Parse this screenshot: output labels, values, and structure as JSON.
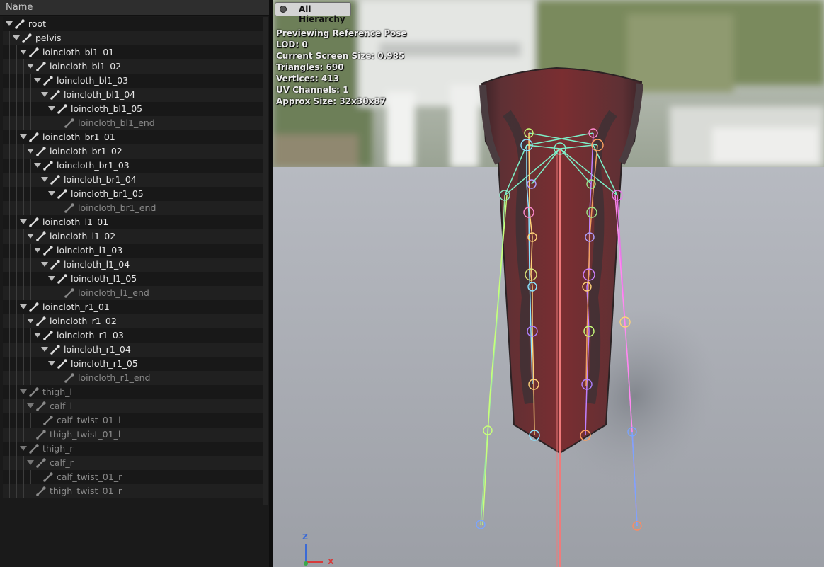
{
  "tree": {
    "header": "Name",
    "rows": [
      {
        "label": "root",
        "depth": 0,
        "expand": true,
        "dim": false
      },
      {
        "label": "pelvis",
        "depth": 1,
        "expand": true,
        "dim": false
      },
      {
        "label": "loincloth_bl1_01",
        "depth": 2,
        "expand": true,
        "dim": false
      },
      {
        "label": "loincloth_bl1_02",
        "depth": 3,
        "expand": true,
        "dim": false
      },
      {
        "label": "loincloth_bl1_03",
        "depth": 4,
        "expand": true,
        "dim": false
      },
      {
        "label": "loincloth_bl1_04",
        "depth": 5,
        "expand": true,
        "dim": false
      },
      {
        "label": "loincloth_bl1_05",
        "depth": 6,
        "expand": true,
        "dim": false
      },
      {
        "label": "loincloth_bl1_end",
        "depth": 7,
        "expand": false,
        "dim": true
      },
      {
        "label": "loincloth_br1_01",
        "depth": 2,
        "expand": true,
        "dim": false
      },
      {
        "label": "loincloth_br1_02",
        "depth": 3,
        "expand": true,
        "dim": false
      },
      {
        "label": "loincloth_br1_03",
        "depth": 4,
        "expand": true,
        "dim": false
      },
      {
        "label": "loincloth_br1_04",
        "depth": 5,
        "expand": true,
        "dim": false
      },
      {
        "label": "loincloth_br1_05",
        "depth": 6,
        "expand": true,
        "dim": false
      },
      {
        "label": "loincloth_br1_end",
        "depth": 7,
        "expand": false,
        "dim": true
      },
      {
        "label": "loincloth_l1_01",
        "depth": 2,
        "expand": true,
        "dim": false
      },
      {
        "label": "loincloth_l1_02",
        "depth": 3,
        "expand": true,
        "dim": false
      },
      {
        "label": "loincloth_l1_03",
        "depth": 4,
        "expand": true,
        "dim": false
      },
      {
        "label": "loincloth_l1_04",
        "depth": 5,
        "expand": true,
        "dim": false
      },
      {
        "label": "loincloth_l1_05",
        "depth": 6,
        "expand": true,
        "dim": false
      },
      {
        "label": "loincloth_l1_end",
        "depth": 7,
        "expand": false,
        "dim": true
      },
      {
        "label": "loincloth_r1_01",
        "depth": 2,
        "expand": true,
        "dim": false
      },
      {
        "label": "loincloth_r1_02",
        "depth": 3,
        "expand": true,
        "dim": false
      },
      {
        "label": "loincloth_r1_03",
        "depth": 4,
        "expand": true,
        "dim": false
      },
      {
        "label": "loincloth_r1_04",
        "depth": 5,
        "expand": true,
        "dim": false
      },
      {
        "label": "loincloth_r1_05",
        "depth": 6,
        "expand": true,
        "dim": false
      },
      {
        "label": "loincloth_r1_end",
        "depth": 7,
        "expand": false,
        "dim": true
      },
      {
        "label": "thigh_l",
        "depth": 2,
        "expand": true,
        "dim": true
      },
      {
        "label": "calf_l",
        "depth": 3,
        "expand": true,
        "dim": true
      },
      {
        "label": "calf_twist_01_l",
        "depth": 4,
        "expand": false,
        "dim": true
      },
      {
        "label": "thigh_twist_01_l",
        "depth": 3,
        "expand": false,
        "dim": true
      },
      {
        "label": "thigh_r",
        "depth": 2,
        "expand": true,
        "dim": true
      },
      {
        "label": "calf_r",
        "depth": 3,
        "expand": true,
        "dim": true
      },
      {
        "label": "calf_twist_01_r",
        "depth": 4,
        "expand": false,
        "dim": true
      },
      {
        "label": "thigh_twist_01_r",
        "depth": 3,
        "expand": false,
        "dim": true
      }
    ]
  },
  "viewport": {
    "hierarchy_button": "All Hierarchy",
    "stats": [
      "Previewing Reference Pose",
      "LOD: 0",
      "Current Screen Size: 0.985",
      "Triangles: 690",
      "Vertices: 413",
      "UV Channels: 1",
      "Approx Size: 32x30x87"
    ],
    "axis": {
      "z": "Z",
      "x": "X"
    }
  },
  "icons": {
    "bone": "bone-icon",
    "expand": "expand-arrow-icon"
  },
  "colors": {
    "panel": "#1a1a1a",
    "header": "#2e2e2e",
    "floor": "#a9abb0",
    "cloth": "#6e2a2c"
  }
}
